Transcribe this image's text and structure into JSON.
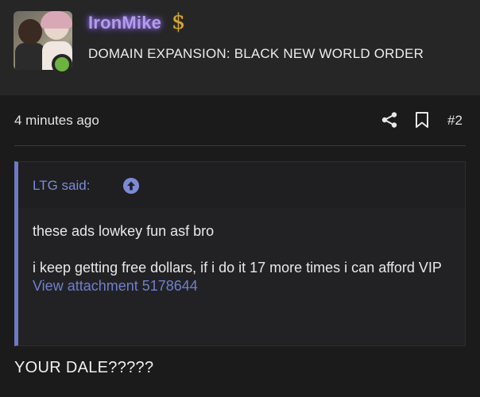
{
  "header": {
    "username": "IronMike",
    "user_title": "DOMAIN EXPANSION: BLACK NEW WORLD ORDER",
    "badge_icon": "dollar-icon",
    "online_status": "online",
    "colors": {
      "username": "#b39ce8",
      "online": "#6cb33f",
      "badge": "#d4a73c"
    }
  },
  "meta": {
    "timestamp": "4 minutes ago",
    "post_number": "#2",
    "icons": [
      "share-icon",
      "bookmark-icon"
    ]
  },
  "quote": {
    "author": "LTG said:",
    "line1": "these ads lowkey fun asf bro",
    "line2": "i keep getting free dollars, if i do it 17 more times i can afford VIP",
    "attachment": "View attachment 5178644",
    "accent_color": "#6f79c4"
  },
  "post": {
    "body": "YOUR DALE?????"
  }
}
